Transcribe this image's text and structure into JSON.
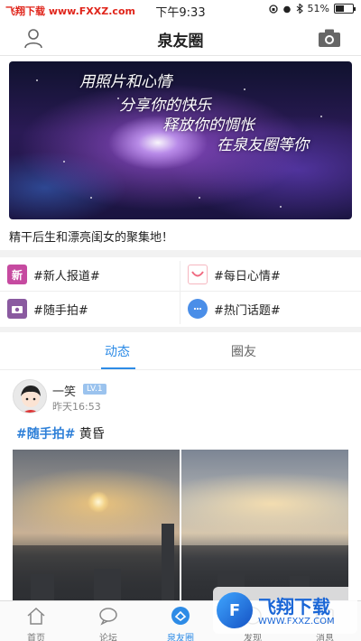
{
  "status_bar": {
    "watermark": "飞翔下载 www.FXXZ.com",
    "time": "下午9:33",
    "battery": "51%",
    "battery_level": 0.51
  },
  "header": {
    "title": "泉友圈",
    "left_icon": "user-icon",
    "right_icon": "camera-icon"
  },
  "banner": {
    "lines": [
      "用照片和心情",
      "分享你的快乐",
      "释放你的惆怅",
      "在泉友圈等你"
    ],
    "caption": "精干后生和漂亮闺女的聚集地！"
  },
  "topics": [
    {
      "label": "#新人报道#",
      "icon": "newcomer-icon",
      "color": "#c64aa0"
    },
    {
      "label": "#每日心情#",
      "icon": "smile-icon",
      "color": "#f08090"
    },
    {
      "label": "#随手拍#",
      "icon": "snapshot-icon",
      "color": "#8a5aa0"
    },
    {
      "label": "#热门话题#",
      "icon": "chat-bubble-icon",
      "color": "#4a8ee8"
    }
  ],
  "tabs": [
    {
      "label": "动态",
      "active": true
    },
    {
      "label": "圈友",
      "active": false
    }
  ],
  "post": {
    "username": "一笑",
    "level": "LV.1",
    "time": "昨天16:53",
    "tag": "#随手拍#",
    "text": " 黄昏"
  },
  "tabbar": [
    {
      "label": "首页",
      "icon": "home-icon",
      "active": false
    },
    {
      "label": "论坛",
      "icon": "forum-icon",
      "active": false
    },
    {
      "label": "泉友圈",
      "icon": "circle-icon",
      "active": true
    },
    {
      "label": "发现",
      "icon": "discover-icon",
      "active": false
    },
    {
      "label": "消息",
      "icon": "message-icon",
      "active": false
    }
  ],
  "overlay_watermark": {
    "title": "飞翔下载",
    "url": "WWW.FXXZ.COM",
    "logo_letter": "F"
  },
  "colors": {
    "accent": "#2d8be6",
    "brand_watermark": "#e0251b"
  }
}
